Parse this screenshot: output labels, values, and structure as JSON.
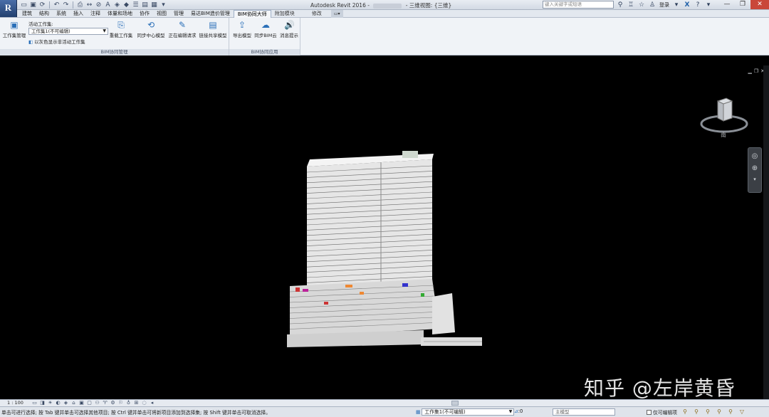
{
  "titlebar": {
    "app_letter": "R",
    "title_prefix": "Autodesk Revit 2016 - ",
    "title_suffix": " - 三维视图: {三维}",
    "search_placeholder": "键入关键字或短语",
    "login_label": "登录",
    "qat_icons": [
      "open-icon",
      "save-icon",
      "sync-icon",
      "undo-icon",
      "redo-icon",
      "print-icon",
      "measure-icon",
      "dimension-icon",
      "text-icon",
      "3d-view-icon",
      "section-icon",
      "thin-lines-icon",
      "close-hidden-icon",
      "switch-windows-icon",
      "dropdown-icon"
    ]
  },
  "tabs": [
    {
      "label": "建筑"
    },
    {
      "label": "结构"
    },
    {
      "label": "系统"
    },
    {
      "label": "插入"
    },
    {
      "label": "注释"
    },
    {
      "label": "体量和场地"
    },
    {
      "label": "协作"
    },
    {
      "label": "视图"
    },
    {
      "label": "管理"
    },
    {
      "label": "易达BIM造价管理"
    },
    {
      "label": "BIM协同大师",
      "active": true
    },
    {
      "label": "附加模块"
    },
    {
      "label": "修改"
    }
  ],
  "ribbon": {
    "panel1": {
      "title": "BIM协同管理",
      "workset_manage": "工作集管理",
      "active_workset_label": "活动工作集:",
      "active_workset_value": "工作集1(不可编辑)",
      "gray_display": "以灰色显示非活动工作集",
      "reload": "重载工作集",
      "sync_center": "同步中心模型",
      "editing_request": "正在编辑请求",
      "link_shared": "链接共享模型"
    },
    "panel2": {
      "title": "BIM协同应用",
      "export_model": "导出模型",
      "sync_cloud": "同步BIM云",
      "message": "消息提示"
    }
  },
  "view": {
    "viewcube_label": "南",
    "watermark": "知乎 @左岸黄昏"
  },
  "view_bar": {
    "scale": "1 : 100"
  },
  "statusbar": {
    "hint": "单击可进行选择; 按 Tab 键并单击可选择其他项目; 按 Ctrl 键并单击可将新项目添加到选择集; 按 Shift 键并单击可取消选择。",
    "workset": "工作集1(不可编辑)",
    "count": ":0",
    "model_placeholder": "主模型",
    "editable_only": "仅可编辑项"
  }
}
